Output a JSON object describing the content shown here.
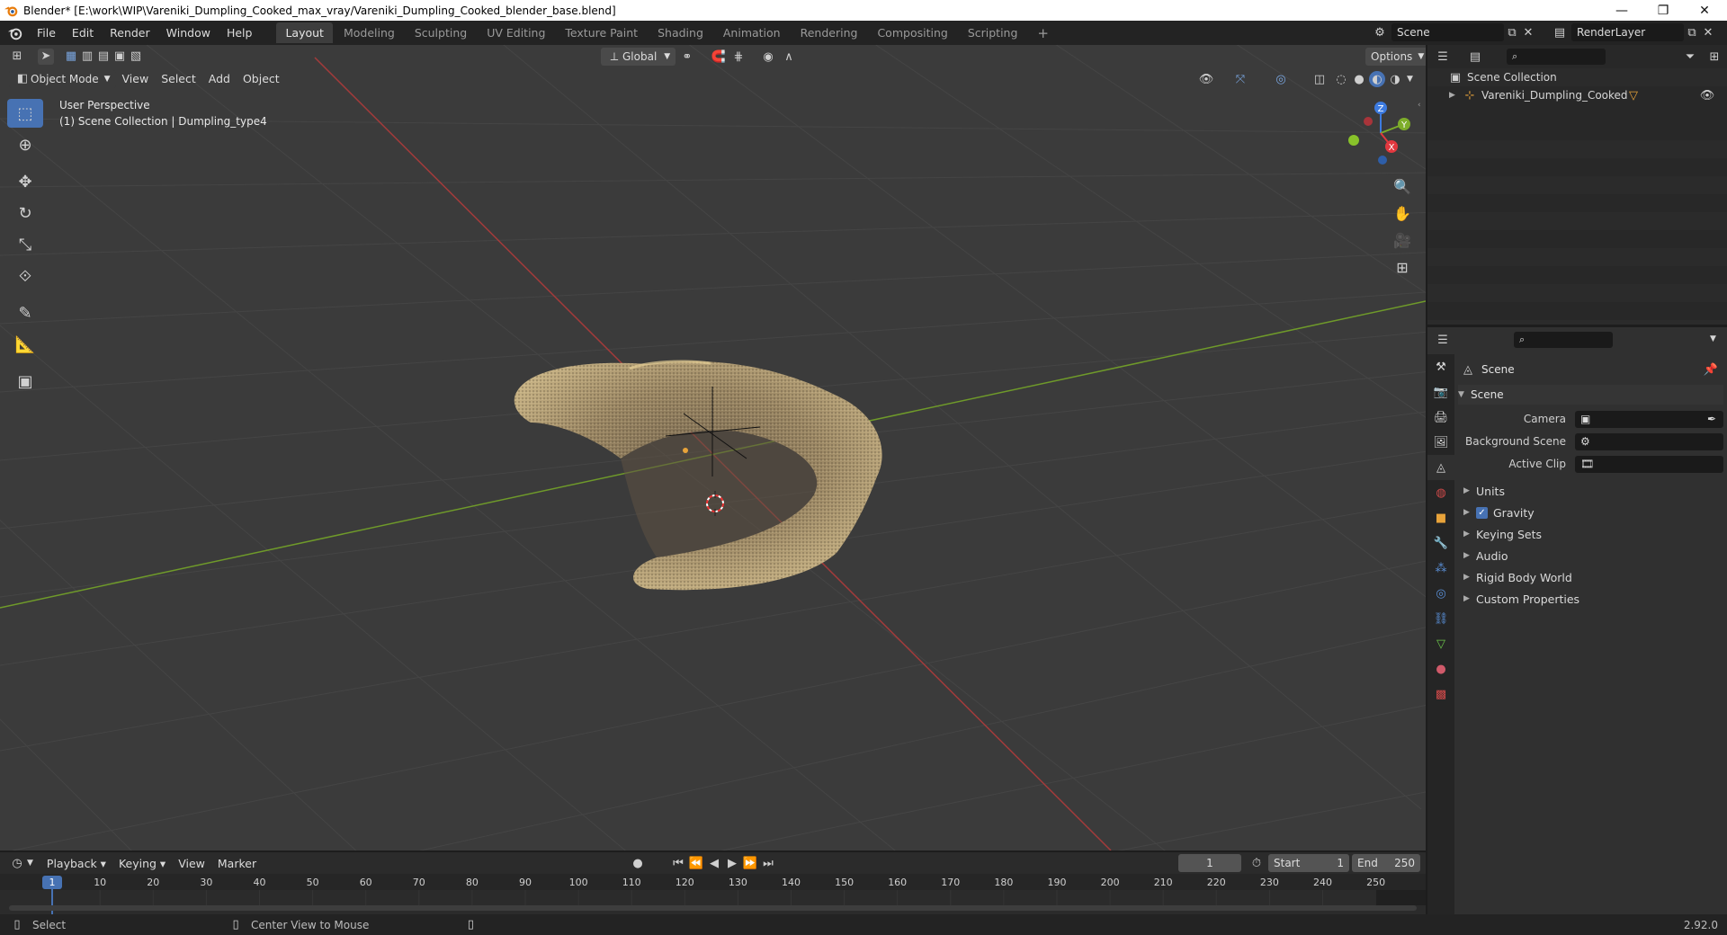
{
  "window": {
    "title": "Blender* [E:\\work\\WIP\\Vareniki_Dumpling_Cooked_max_vray/Vareniki_Dumpling_Cooked_blender_base.blend]",
    "minimize": "—",
    "restore": "❐",
    "close": "✕"
  },
  "menu": {
    "items": [
      "File",
      "Edit",
      "Render",
      "Window",
      "Help"
    ]
  },
  "workspaces": [
    "Layout",
    "Modeling",
    "Sculpting",
    "UV Editing",
    "Texture Paint",
    "Shading",
    "Animation",
    "Rendering",
    "Compositing",
    "Scripting"
  ],
  "workspace_add": "+",
  "scene": {
    "name": "Scene",
    "render_layer": "RenderLayer"
  },
  "viewport": {
    "transform_orientation": "Global",
    "options_label": "Options",
    "mode": "Object Mode",
    "header_menus": [
      "View",
      "Select",
      "Add",
      "Object"
    ],
    "overlay_line1": "User Perspective",
    "overlay_line2": "(1) Scene Collection | Dumpling_type4",
    "gizmo_axes": {
      "z": "Z",
      "y": "Y",
      "x": "X"
    }
  },
  "outliner": {
    "root": "Scene Collection",
    "items": [
      {
        "name": "Vareniki_Dumpling_Cooked"
      }
    ]
  },
  "properties": {
    "context_title": "Scene",
    "section_title": "Scene",
    "fields": [
      {
        "label": "Camera"
      },
      {
        "label": "Background Scene"
      },
      {
        "label": "Active Clip"
      }
    ],
    "subpanels": [
      "Units",
      "Gravity",
      "Keying Sets",
      "Audio",
      "Rigid Body World",
      "Custom Properties"
    ],
    "gravity_checked": true
  },
  "timeline": {
    "menus": [
      "Playback",
      "Keying",
      "View",
      "Marker"
    ],
    "current_frame": "1",
    "start_label": "Start",
    "start_value": "1",
    "end_label": "End",
    "end_value": "250",
    "ruler": [
      "1",
      "10",
      "20",
      "30",
      "40",
      "50",
      "60",
      "70",
      "80",
      "90",
      "100",
      "110",
      "120",
      "130",
      "140",
      "150",
      "160",
      "170",
      "180",
      "190",
      "200",
      "210",
      "220",
      "230",
      "240",
      "250"
    ]
  },
  "status": {
    "select": "Select",
    "center_view": "Center View to Mouse",
    "version": "2.92.0"
  },
  "colors": {
    "accent": "#4772b3",
    "x_axis": "#a33b3b",
    "y_axis": "#6f9a2a",
    "viewport_bg": "#3b3b3b"
  }
}
